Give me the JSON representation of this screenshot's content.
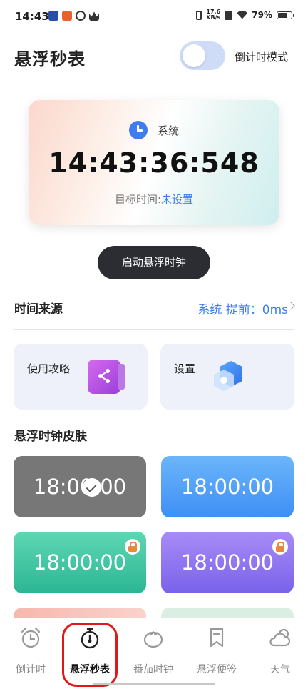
{
  "status_bar": {
    "time": "14:43",
    "net_speed_value": "17.6",
    "net_speed_unit": "KB/s",
    "battery": "79%",
    "battery_level": 0.79
  },
  "header": {
    "title": "悬浮秒表",
    "mode_label": "倒计时模式",
    "mode_enabled": false
  },
  "clock_card": {
    "source": "系统",
    "time": "14:43:36:548",
    "target_label": "目标时间:",
    "target_value": "未设置"
  },
  "start_button": "启动悬浮时钟",
  "time_source": {
    "title": "时间来源",
    "summary": "系统 提前：0ms"
  },
  "features": {
    "guide": "使用攻略",
    "settings": "设置"
  },
  "skins": {
    "title": "悬浮时钟皮肤",
    "items": [
      {
        "time": "18:00:00",
        "selected": true,
        "locked": false
      },
      {
        "time": "18:00:00",
        "selected": false,
        "locked": false
      },
      {
        "time": "18:00:00",
        "selected": false,
        "locked": true
      },
      {
        "time": "18:00:00",
        "selected": false,
        "locked": true
      }
    ]
  },
  "bottom_nav": {
    "items": [
      {
        "label": "倒计时",
        "icon": "alarm-clock-icon",
        "active": false
      },
      {
        "label": "悬浮秒表",
        "icon": "stopwatch-icon",
        "active": true
      },
      {
        "label": "番茄时钟",
        "icon": "tomato-icon",
        "active": false
      },
      {
        "label": "悬浮便签",
        "icon": "bookmark-icon",
        "active": false
      },
      {
        "label": "天气",
        "icon": "weather-icon",
        "active": false
      }
    ]
  },
  "colors": {
    "accent": "#3f7cf0",
    "active_highlight": "#e01818"
  }
}
